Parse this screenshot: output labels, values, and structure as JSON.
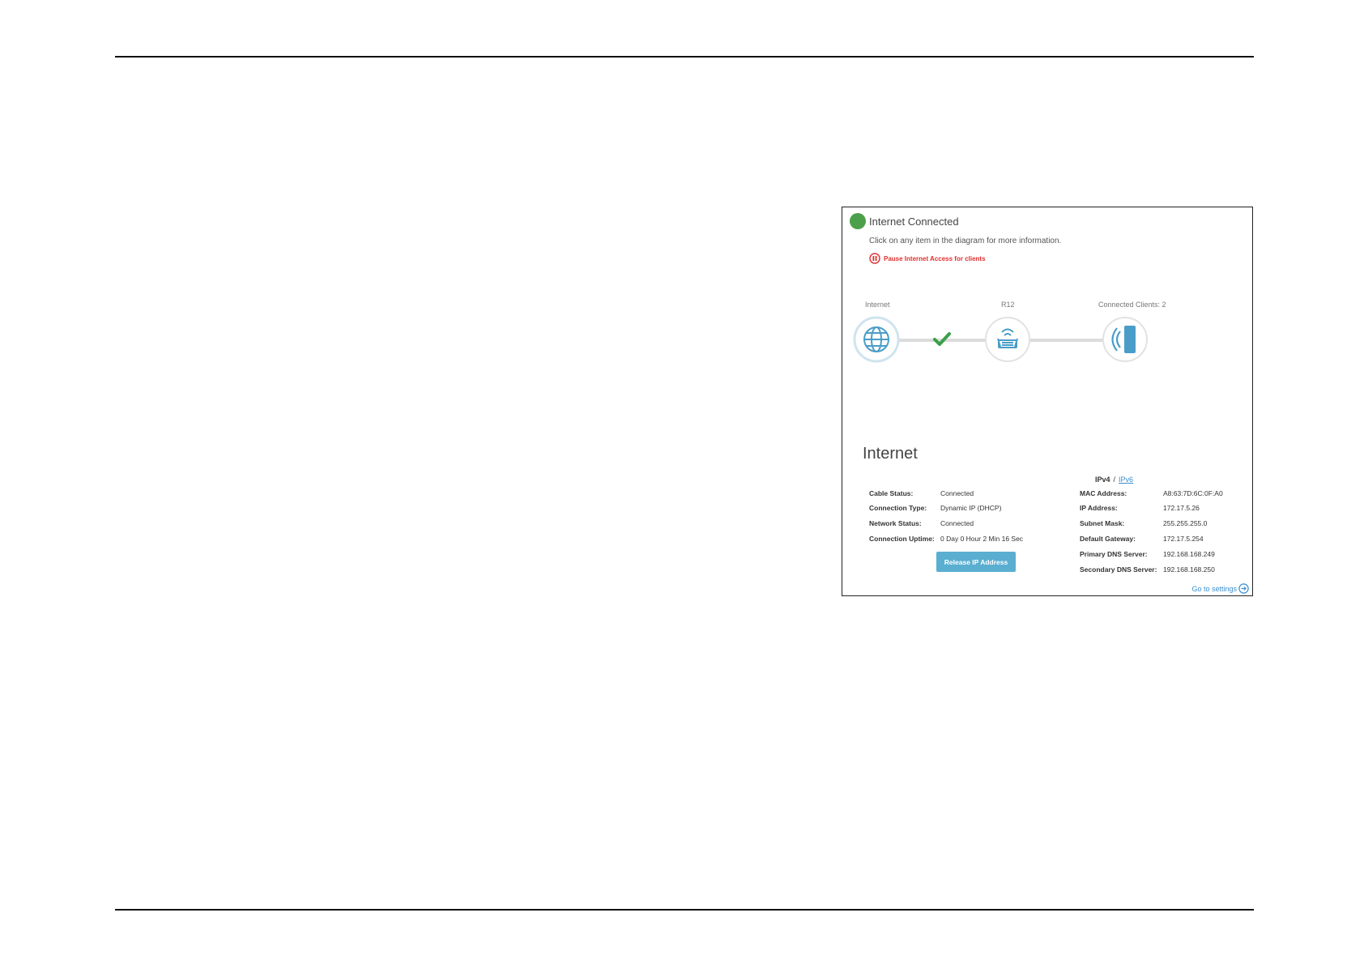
{
  "status": {
    "title": "Internet Connected",
    "color": "#4ca04c",
    "instruction": "Click on any item in the diagram for more information.",
    "pause_label": "Pause Internet Access for clients"
  },
  "diagram": {
    "internet_label": "Internet",
    "router_label": "R12",
    "clients_label": "Connected Clients: 2",
    "icons": [
      "globe-icon",
      "check-icon",
      "router-icon",
      "wireless-client-icon"
    ]
  },
  "section": {
    "title": "Internet",
    "ipv4_label": "IPv4",
    "separator": "/",
    "ipv6_label": "IPv6"
  },
  "left_info": [
    {
      "label": "Cable Status:",
      "value": "Connected"
    },
    {
      "label": "Connection Type:",
      "value": "Dynamic IP (DHCP)"
    },
    {
      "label": "Network Status:",
      "value": "Connected"
    },
    {
      "label": "Connection Uptime:",
      "value": "0 Day 0 Hour 2 Min 16 Sec"
    }
  ],
  "right_info": [
    {
      "label": "MAC Address:",
      "value": "A8:63:7D:6C:0F:A0"
    },
    {
      "label": "IP Address:",
      "value": "172.17.5.26"
    },
    {
      "label": "Subnet Mask:",
      "value": "255.255.255.0"
    },
    {
      "label": "Default Gateway:",
      "value": "172.17.5.254"
    },
    {
      "label": "Primary DNS Server:",
      "value": "192.168.168.249"
    },
    {
      "label": "Secondary DNS Server:",
      "value": "192.168.168.250"
    }
  ],
  "actions": {
    "release_button": "Release IP Address",
    "settings_link": "Go to settings"
  },
  "colors": {
    "accent_blue": "#3a8fd0",
    "button": "#5aaed0",
    "warning": "#e03030",
    "node_icon": "#4a9dc8"
  }
}
